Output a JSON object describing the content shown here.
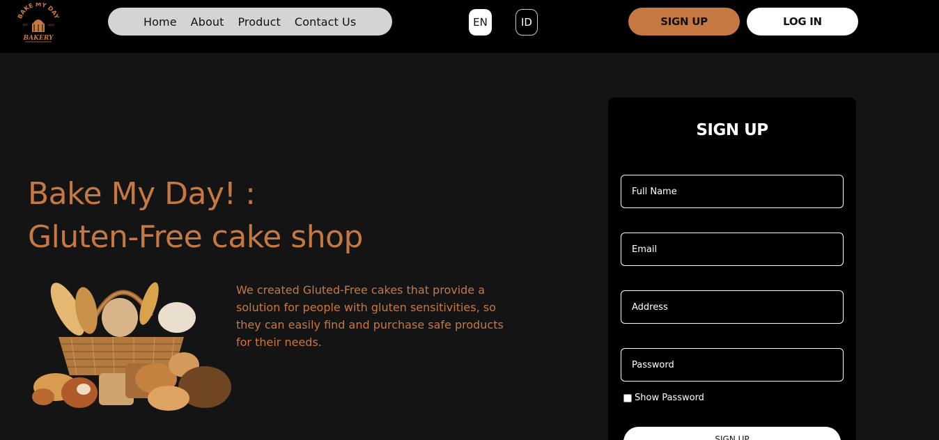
{
  "logo": {
    "line1": "BAKE MY DAY",
    "line2": "BAKERY",
    "left_mark": "EST",
    "right_mark": "2024"
  },
  "nav": {
    "items": [
      "Home",
      "About",
      "Product",
      "Contact Us"
    ]
  },
  "lang": {
    "en": "EN",
    "id": "ID"
  },
  "auth": {
    "signup": "SIGN UP",
    "login": "LOG IN"
  },
  "hero": {
    "title_line1": "Bake My Day! :",
    "title_line2": "Gluten-Free cake shop",
    "description": "We created Gluted-Free cakes that provide a solution for people with gluten sensitivities, so they can easily find and purchase safe products for their needs."
  },
  "form": {
    "title": "SIGN UP",
    "fullname_placeholder": "Full Name",
    "email_placeholder": "Email",
    "address_placeholder": "Address",
    "password_placeholder": "Password",
    "show_password": "Show Password",
    "submit": "SIGN UP"
  },
  "colors": {
    "accent": "#c67842",
    "background": "#141414",
    "topbar": "#000000",
    "nav_pill": "#d4d4d4"
  }
}
